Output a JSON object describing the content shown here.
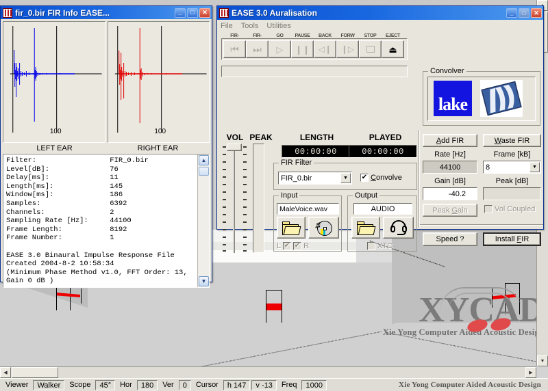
{
  "viewport": {
    "name": "ease-3d-viewport",
    "speakers": 3
  },
  "watermark": {
    "logo": "XYCAD",
    "tagline": "Xie Yong Computer Aided Acoustic Design"
  },
  "statusbar": {
    "items": [
      {
        "label": "Viewer",
        "boxed": false
      },
      {
        "label": "Walker",
        "boxed": true
      },
      {
        "label": "Scope",
        "boxed": false
      },
      {
        "label": "45°",
        "boxed": true
      },
      {
        "label": "Hor",
        "boxed": false
      },
      {
        "label": "180",
        "boxed": true
      },
      {
        "label": "Ver",
        "boxed": false
      },
      {
        "label": "0",
        "boxed": true
      },
      {
        "label": "Cursor",
        "boxed": false
      },
      {
        "label": "h 147",
        "boxed": true
      },
      {
        "label": "v -13",
        "boxed": true
      },
      {
        "label": "Freq",
        "boxed": false
      },
      {
        "label": "1000",
        "boxed": true
      }
    ],
    "right_text": "Xie Yong Computer Aided Acoustic Design"
  },
  "fir_info_window": {
    "title": "fir_0.bir FIR Info EASE...",
    "minimize_label": "_",
    "maximize_label": "□",
    "close_label": "✕",
    "plots": {
      "left": {
        "label": "LEFT EAR",
        "tick": "100",
        "color": "#0000e6"
      },
      "right": {
        "label": "RIGHT EAR",
        "tick": "100",
        "color": "#e00000"
      }
    },
    "info_text": "Filter:                 FIR_0.bir\nLevel[dB]:              76\nDelay[ms]:              11\nLength[ms]:             145\nWindow[ms]:             186\nSamples:                6392\nChannels:               2\nSampling Rate [Hz]:     44100\nFrame Length:           8192\nFrame Number:           1\n\nEASE 3.0 Binaural Impulse Response File\nCreated 2004-8-2 10:58:34\n(Minimum Phase Method v1.0, FFT Order: 13,\nGain 0 dB )"
  },
  "ease_window": {
    "title": "EASE 3.0 Auralisation",
    "minimize_label": "_",
    "maximize_label": "□",
    "close_label": "✕",
    "menu": [
      "File",
      "Tools",
      "Utilities"
    ],
    "transport": [
      {
        "label": "FIR-",
        "icon": "skip-back-icon"
      },
      {
        "label": "FIR-",
        "icon": "skip-forward-icon"
      },
      {
        "label": "GO",
        "icon": "play-icon"
      },
      {
        "label": "PAUSE",
        "icon": "pause-icon"
      },
      {
        "label": "BACK",
        "icon": "rewind-icon"
      },
      {
        "label": "FORW",
        "icon": "fast-forward-icon"
      },
      {
        "label": "STOP",
        "icon": "stop-icon"
      },
      {
        "label": "EJECT",
        "icon": "eject-icon"
      }
    ],
    "meters": {
      "vol_label": "VOL",
      "peak_label": "PEAK",
      "length_label": "LENGTH",
      "length_value": "00:00:00",
      "played_label": "PLAYED",
      "played_value": "00:00:00"
    },
    "fir_filter": {
      "group_label": "FIR Filter",
      "value": "FIR_0.bir",
      "convolve_label": "Convolve",
      "convolve_checked": true
    },
    "input": {
      "group_label": "Input",
      "file": "MaleVoice.wav",
      "browse_icon": "folder-icon",
      "cd_icon": "audio-cd-icon",
      "left_label": "L",
      "right_label": "R",
      "left_checked": true,
      "right_checked": true
    },
    "output": {
      "group_label": "Output",
      "device": "AUDIO",
      "browse_icon": "folder-icon",
      "headphone_icon": "headphones-icon",
      "xtc_label": "XTC",
      "xtc_checked": false
    },
    "convolver": {
      "group_label": "Convolver",
      "logo1": "lake",
      "logo2": "EASE"
    },
    "right_panel": {
      "add_fir": "Add FIR",
      "add_fir_accel": "A",
      "waste_fir": "Waste FIR",
      "waste_fir_accel": "W",
      "rate_label": "Rate [Hz]",
      "rate_value": "44100",
      "frame_label": "Frame [kB]",
      "frame_value": "8",
      "gain_label": "Gain [dB]",
      "gain_value": "-40.2",
      "peak_label": "Peak [dB]",
      "peak_value": "",
      "peak_gain": "Peak Gain",
      "peak_gain_accel": "G",
      "vol_coupled": "Vol Coupled",
      "vol_coupled_checked": false,
      "speed": "Speed ?",
      "install_fir": "Install FIR",
      "install_fir_accel": "F"
    }
  },
  "colors": {
    "title_blue": "#0a4fd0",
    "face": "#e8e5dc",
    "accent_red": "#ee0000",
    "accent_blue": "#0000e6",
    "lake_blue": "#1414e0"
  }
}
